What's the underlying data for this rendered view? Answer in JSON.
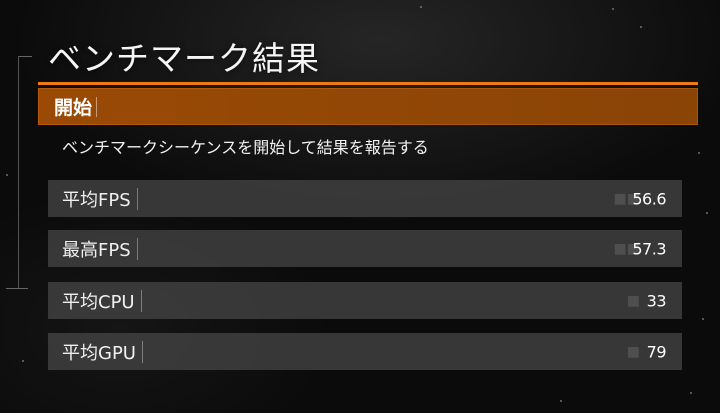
{
  "title": "ベンチマーク結果",
  "start": {
    "label": "開始"
  },
  "description": "ベンチマークシーケンスを開始して結果を報告する",
  "stats": [
    {
      "label": "平均FPS",
      "value": "56.6"
    },
    {
      "label": "最高FPS",
      "value": "57.3"
    },
    {
      "label": "平均CPU",
      "value": "33"
    },
    {
      "label": "平均GPU",
      "value": "79"
    }
  ],
  "colors": {
    "accent": "#f07a10",
    "selected_row": "#9a4a05",
    "row_bg": "#484848"
  }
}
